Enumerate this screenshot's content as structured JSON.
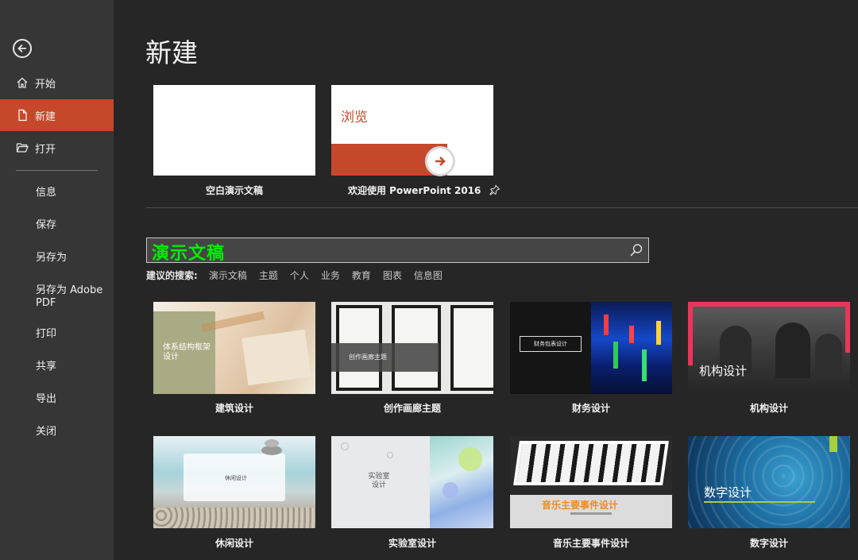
{
  "sidebar": {
    "items": [
      {
        "label": "开始",
        "icon": "home-icon"
      },
      {
        "label": "新建",
        "icon": "new-document-icon",
        "active": true
      },
      {
        "label": "打开",
        "icon": "folder-open-icon"
      }
    ],
    "plain_items": [
      "信息",
      "保存",
      "另存为",
      "另存为 Adobe PDF",
      "打印",
      "共享",
      "导出",
      "关闭"
    ]
  },
  "page": {
    "title": "新建"
  },
  "top_templates": {
    "blank": {
      "label": "空白演示文稿"
    },
    "browse": {
      "label": "欢迎使用 PowerPoint 2016",
      "card_text": "浏览"
    }
  },
  "search": {
    "value": "演示文稿"
  },
  "suggestions": {
    "lead": "建议的搜索:",
    "items": [
      "演示文稿",
      "主题",
      "个人",
      "业务",
      "教育",
      "图表",
      "信息图"
    ]
  },
  "templates": [
    {
      "label": "建筑设计",
      "thumb_title": "体系结构框架设计"
    },
    {
      "label": "创作画廊主题",
      "thumb_title": "创作画廊主题"
    },
    {
      "label": "财务设计",
      "thumb_title": "财务包表设计"
    },
    {
      "label": "机构设计",
      "thumb_title": "机构设计"
    },
    {
      "label": "休闲设计",
      "thumb_title": "休闲设计"
    },
    {
      "label": "实验室设计",
      "thumb_title": "实验室设计"
    },
    {
      "label": "音乐主要事件设计",
      "thumb_title": "音乐主要事件设计"
    },
    {
      "label": "数字设计",
      "thumb_title": "数字设计"
    }
  ],
  "colors": {
    "accent": "#c6482a",
    "search_text": "#00f000",
    "background": "#262626",
    "sidebar": "#363636"
  }
}
